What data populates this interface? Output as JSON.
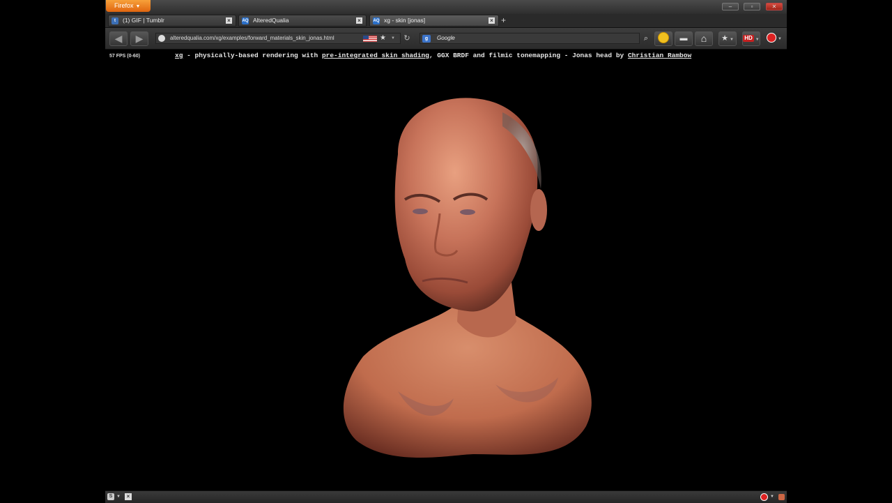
{
  "browser": {
    "menu_button": "Firefox",
    "tabs": [
      {
        "label": "(1) GIF | Tumblr",
        "icon": "t",
        "icon_color": "#3b6fb6"
      },
      {
        "label": "AlteredQualia",
        "icon": "AQ",
        "icon_color": "#2a6fc9"
      },
      {
        "label": "xg - skin [jonas]",
        "icon": "AQ",
        "icon_color": "#2a6fc9",
        "active": true
      }
    ],
    "new_tab": "+",
    "url": "alteredqualia.com/xg/examples/forward_materials_skin_jonas.html",
    "search_engine": "g",
    "search_placeholder": "Google"
  },
  "page": {
    "fps": "57 FPS (0-60)",
    "caption": {
      "link_xg": "xg",
      "text1": " - physically-based rendering with ",
      "link_skin": "pre-integrated skin shading",
      "text2": ", GGX BRDF and filmic tonemapping - Jonas head by ",
      "link_author": "Christian Rambow"
    }
  },
  "colors": {
    "accent": "#e0650f",
    "chrome": "#3a3a3a"
  }
}
